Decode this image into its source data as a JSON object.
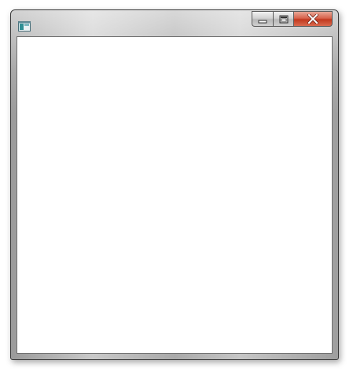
{
  "window": {
    "title": "",
    "icon": "application-window-icon",
    "controls": [
      {
        "name": "minimize-button",
        "icon": "minimize-icon"
      },
      {
        "name": "maximize-button",
        "icon": "maximize-icon"
      },
      {
        "name": "close-button",
        "icon": "close-icon"
      }
    ],
    "client_area": {
      "background": "#ffffff"
    }
  },
  "colors": {
    "frame": "#a9a9a9",
    "close_button": "#c9442a",
    "client_background": "#ffffff"
  }
}
